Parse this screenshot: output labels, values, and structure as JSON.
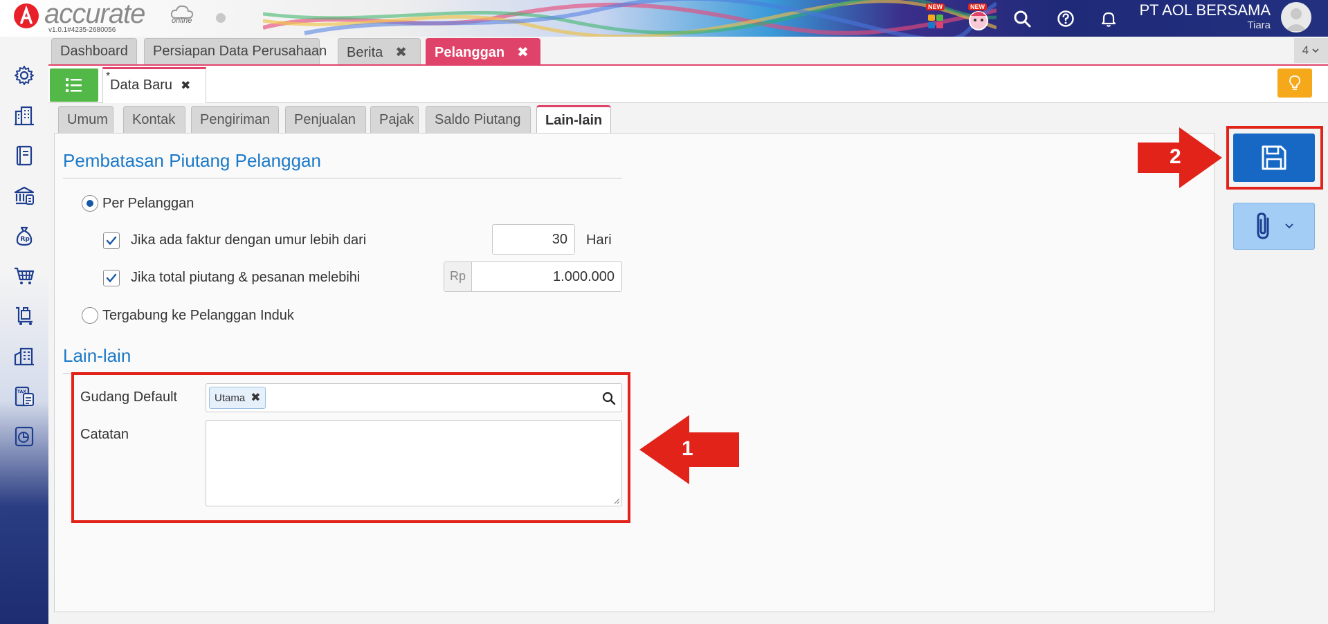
{
  "header": {
    "logo_text": "accurate",
    "logo_online": "online",
    "version": "v1.0.1#4235-2680056",
    "new_badge": "NEW",
    "company_name": "PT AOL BERSAMA",
    "user_name": "Tiara"
  },
  "app_tabs": [
    {
      "label": "Dashboard"
    },
    {
      "label": "Persiapan Data Perusahaan"
    },
    {
      "label": "Berita"
    },
    {
      "label": "Pelanggan"
    }
  ],
  "tab_count": "4",
  "doc_tab": {
    "star": "*",
    "label": "Data Baru"
  },
  "form_tabs": [
    "Umum",
    "Kontak",
    "Pengiriman",
    "Penjualan",
    "Pajak",
    "Saldo Piutang",
    "Lain-lain"
  ],
  "credit_limit": {
    "title": "Pembatasan Piutang Pelanggan",
    "per_customer_label": "Per Pelanggan",
    "age_check_label": "Jika ada faktur dengan umur lebih dari",
    "age_value": "30",
    "age_unit": "Hari",
    "total_check_label": "Jika total piutang & pesanan melebihi",
    "currency_prefix": "Rp",
    "total_value": "1.000.000",
    "parent_label": "Tergabung ke Pelanggan Induk"
  },
  "others": {
    "title": "Lain-lain",
    "warehouse_label": "Gudang Default",
    "warehouse_tag": "Utama",
    "notes_label": "Catatan",
    "notes_value": ""
  },
  "annotations": {
    "step1": "1",
    "step2": "2"
  },
  "colors": {
    "accent_pink": "#e0436a",
    "brand_blue": "#1b79c8",
    "save_blue": "#1668c4",
    "annotation_red": "#e2231a",
    "list_green": "#52b848"
  }
}
